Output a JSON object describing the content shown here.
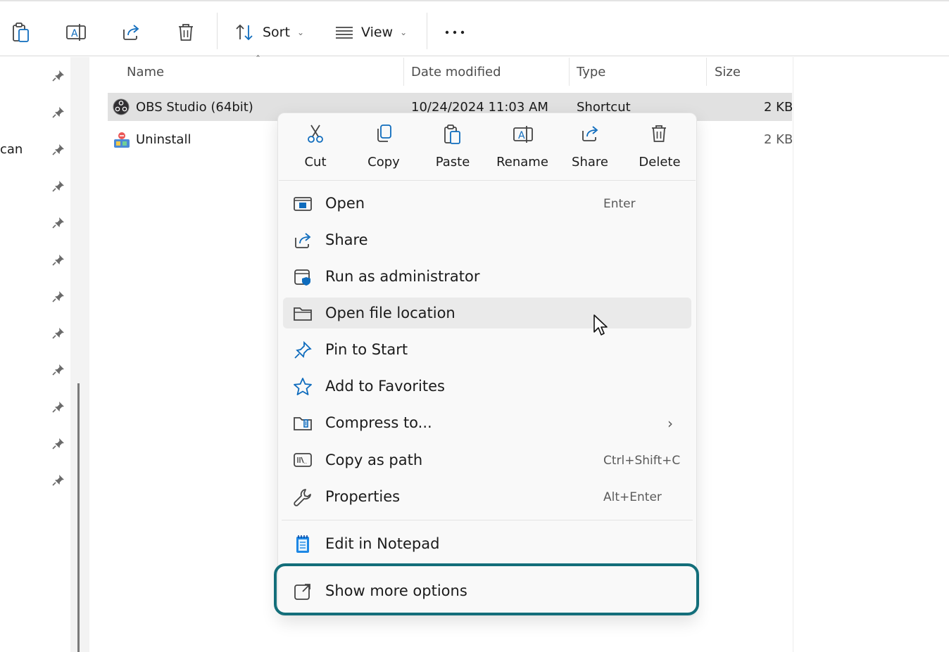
{
  "toolbar": {
    "paste_icon": "paste-icon",
    "rename_icon": "rename-icon",
    "share_icon": "share-icon",
    "delete_icon": "delete-icon",
    "sort_label": "Sort",
    "view_label": "View",
    "more_icon": "more-icon"
  },
  "nav": {
    "partial_text": "can",
    "pin_count": 12
  },
  "columns": {
    "name": "Name",
    "date": "Date modified",
    "type": "Type",
    "size": "Size"
  },
  "files": [
    {
      "name": "OBS Studio (64bit)",
      "date": "10/24/2024 11:03 AM",
      "type": "Shortcut",
      "size": "2 KB",
      "selected": true
    },
    {
      "name": "Uninstall",
      "date": "",
      "type": "",
      "size": "2 KB",
      "selected": false
    }
  ],
  "context_menu": {
    "quick_actions": [
      {
        "label": "Cut",
        "icon": "cut-icon"
      },
      {
        "label": "Copy",
        "icon": "copy-icon"
      },
      {
        "label": "Paste",
        "icon": "paste-icon"
      },
      {
        "label": "Rename",
        "icon": "rename-icon"
      },
      {
        "label": "Share",
        "icon": "share-icon"
      },
      {
        "label": "Delete",
        "icon": "delete-icon"
      }
    ],
    "items": [
      {
        "label": "Open",
        "shortcut": "Enter",
        "icon": "open-icon"
      },
      {
        "label": "Share",
        "shortcut": "",
        "icon": "share-icon"
      },
      {
        "label": "Run as administrator",
        "shortcut": "",
        "icon": "admin-shield-icon"
      },
      {
        "label": "Open file location",
        "shortcut": "",
        "icon": "folder-icon",
        "hovered": true
      },
      {
        "label": "Pin to Start",
        "shortcut": "",
        "icon": "pin-icon"
      },
      {
        "label": "Add to Favorites",
        "shortcut": "",
        "icon": "star-icon"
      },
      {
        "label": "Compress to...",
        "shortcut": "",
        "icon": "zip-folder-icon",
        "submenu": true
      },
      {
        "label": "Copy as path",
        "shortcut": "Ctrl+Shift+C",
        "icon": "path-icon"
      },
      {
        "label": "Properties",
        "shortcut": "Alt+Enter",
        "icon": "wrench-icon"
      }
    ],
    "extra_items": [
      {
        "label": "Edit in Notepad",
        "icon": "notepad-icon"
      }
    ],
    "show_more": {
      "label": "Show more options",
      "icon": "show-more-icon",
      "highlighted": true
    }
  },
  "colors": {
    "accent": "#0f6cbd",
    "highlight_border": "#136e7a",
    "selection": "#e1e1e1"
  }
}
